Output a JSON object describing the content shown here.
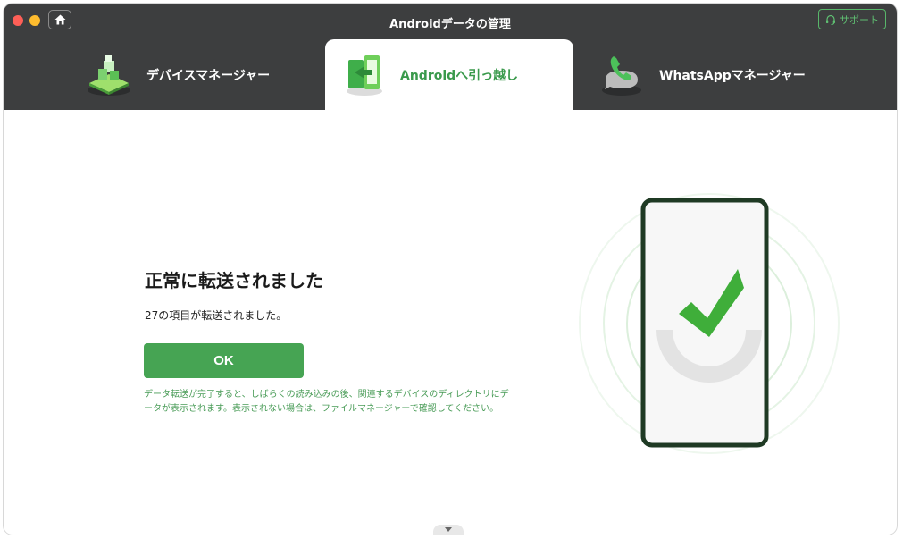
{
  "app": {
    "title": "Androidデータの管理",
    "support_label": "サポート"
  },
  "tabs": [
    {
      "label": "デバイスマネージャー",
      "icon": "device-manager-icon",
      "active": false
    },
    {
      "label": "Androidへ引っ越し",
      "icon": "transfer-icon",
      "active": true
    },
    {
      "label": "WhatsAppマネージャー",
      "icon": "whatsapp-icon",
      "active": false
    }
  ],
  "main": {
    "heading": "正常に転送されました",
    "subtext": "27の項目が転送されました。",
    "ok_label": "OK",
    "note": "データ転送が完了すると、しばらくの読み込みの後、関連するデバイスのディレクトリにデータが表示されます。表示されない場合は、ファイルマネージャーで確認してください。"
  },
  "colors": {
    "accent": "#46a453",
    "titlebar": "#3d3e3f",
    "note_text": "#4a9c58"
  }
}
